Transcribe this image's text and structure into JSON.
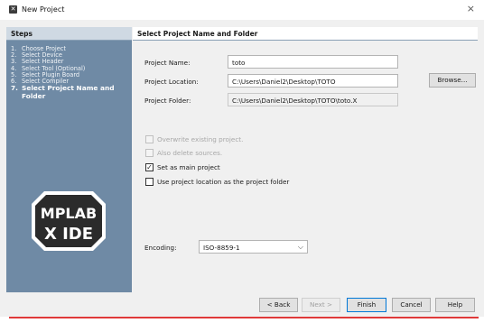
{
  "window": {
    "title": "New Project",
    "close_glyph": "×",
    "icon": "app-dialog-icon"
  },
  "steps": {
    "header": "Steps",
    "items": [
      {
        "num": "1.",
        "label": "Choose Project"
      },
      {
        "num": "2.",
        "label": "Select Device"
      },
      {
        "num": "3.",
        "label": "Select Header"
      },
      {
        "num": "4.",
        "label": "Select Tool (Optional)"
      },
      {
        "num": "5.",
        "label": "Select Plugin Board"
      },
      {
        "num": "6.",
        "label": "Select Compiler"
      },
      {
        "num": "7.",
        "label": "Select Project Name and Folder"
      }
    ]
  },
  "logo": {
    "line1": "MPLAB",
    "line2": "X IDE"
  },
  "content": {
    "header": "Select Project Name and Folder",
    "project_name_label": "Project Name:",
    "project_name_value": "toto",
    "project_location_label": "Project Location:",
    "project_location_value": "C:\\Users\\Daniel2\\Desktop\\TOTO",
    "browse_label": "Browse...",
    "project_folder_label": "Project Folder:",
    "project_folder_value": "C:\\Users\\Daniel2\\Desktop\\TOTO\\toto.X",
    "overwrite_label": "Overwrite existing project.",
    "delete_sources_label": "Also delete sources.",
    "main_project_label": "Set as main project",
    "main_project_checked": true,
    "use_location_label": "Use project location as the project folder",
    "use_location_checked": false,
    "encoding_label": "Encoding:",
    "encoding_value": "ISO-8859-1"
  },
  "footer": {
    "back_label": "< Back",
    "next_label": "Next >",
    "finish_label": "Finish",
    "cancel_label": "Cancel",
    "help_label": "Help"
  },
  "colors": {
    "steps_bg": "#6f8aa5",
    "accent": "#0078d7",
    "underline": "#e03a3a"
  }
}
